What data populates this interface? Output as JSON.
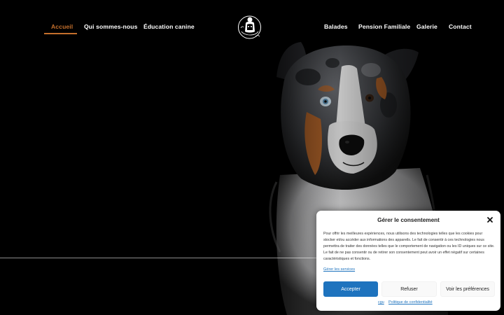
{
  "nav": {
    "left_items": [
      {
        "label": "Accueil",
        "active": true
      },
      {
        "label": "Qui sommes-nous",
        "active": false
      },
      {
        "label": "Éducation canine",
        "active": false
      }
    ],
    "right_items": [
      {
        "label": "Balades",
        "active": false
      },
      {
        "label": "Pension Familiale",
        "active": false
      },
      {
        "label": "Galerie",
        "active": false
      },
      {
        "label": "Contact",
        "active": false
      }
    ],
    "logo_text": "Lola au Nature",
    "active_color": "#c46f2c"
  },
  "hero": {
    "image": "australian-shepherd-dog-portrait",
    "background": "#000000"
  },
  "consent": {
    "title": "Gérer le consentement",
    "body": "Pour offrir les meilleures expériences, nous utilisons des technologies telles que les cookies pour stocker et/ou accéder aux informations des appareils. Le fait de consentir à ces technologies nous permettra de traiter des données telles que le comportement de navigation ou les ID uniques sur ce site. Le fait de ne pas consentir ou de retirer son consentement peut avoir un effet négatif sur certaines caractéristiques et fonctions.",
    "manage_link": "Gérer les services",
    "accept_label": "Accepter",
    "deny_label": "Refuser",
    "prefs_label": "Voir les préférences",
    "cgu_link": "cgu",
    "privacy_link": "Politique de confidentialité",
    "accent_color": "#1e73be"
  }
}
